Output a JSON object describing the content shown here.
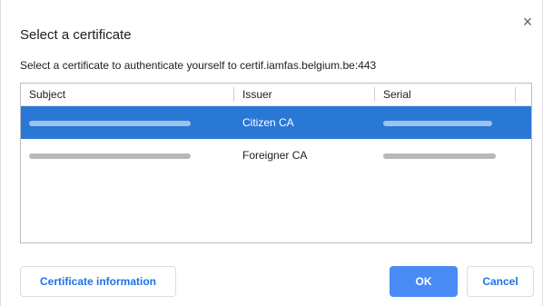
{
  "dialog": {
    "title": "Select a certificate",
    "subtitle": "Select a certificate to authenticate yourself to certif.iamfas.belgium.be:443",
    "close_glyph": "×"
  },
  "table": {
    "columns": [
      "Subject",
      "Issuer",
      "Serial"
    ],
    "rows": [
      {
        "subject": "",
        "issuer": "Citizen CA",
        "serial": "",
        "selected": true
      },
      {
        "subject": "",
        "issuer": "Foreigner CA",
        "serial": "",
        "selected": false
      }
    ]
  },
  "buttons": {
    "info_label": "Certificate information",
    "ok_label": "OK",
    "cancel_label": "Cancel"
  },
  "colors": {
    "accent": "#1a73e8",
    "selection": "#2a78d6",
    "ok_bg": "#4a8af4"
  },
  "icons": {
    "close": "close-icon"
  }
}
